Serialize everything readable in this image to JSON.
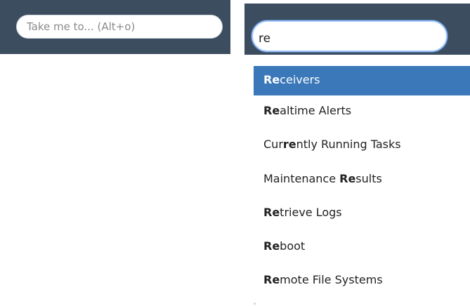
{
  "idle_search": {
    "placeholder": "Take me to... (Alt+o)"
  },
  "active_search": {
    "value": "re"
  },
  "suggestions": [
    {
      "before": "",
      "match": "Re",
      "after": "ceivers",
      "selected": true
    },
    {
      "before": "",
      "match": "Re",
      "after": "altime Alerts",
      "selected": false
    },
    {
      "before": "Cur",
      "match": "re",
      "after": "ntly Running Tasks",
      "selected": false
    },
    {
      "before": "Maintenance ",
      "match": "Re",
      "after": "sults",
      "selected": false
    },
    {
      "before": "",
      "match": "Re",
      "after": "trieve Logs",
      "selected": false
    },
    {
      "before": "",
      "match": "Re",
      "after": "boot",
      "selected": false
    },
    {
      "before": "",
      "match": "Re",
      "after": "mote File Systems",
      "selected": false
    }
  ],
  "colors": {
    "header_bg": "#3b4d5f",
    "selected_bg": "#3a78b9",
    "focus_ring": "#9fc7ff"
  }
}
